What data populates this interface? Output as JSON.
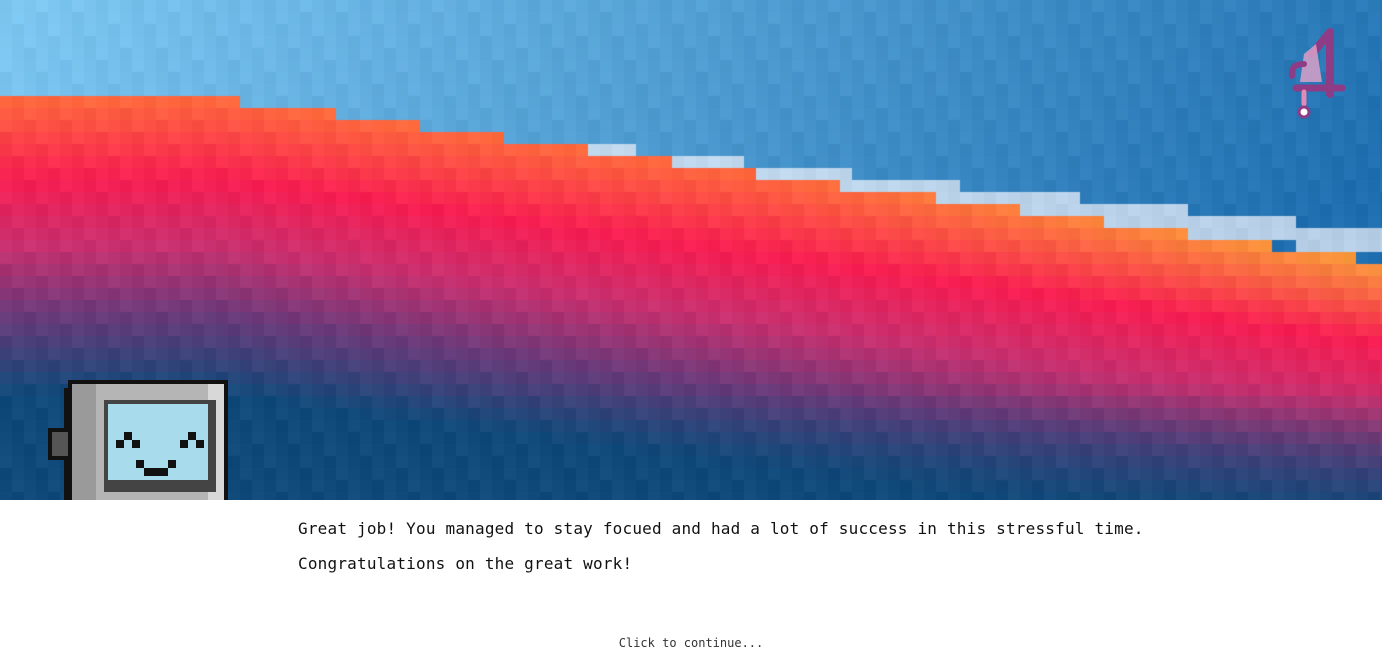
{
  "dialog": {
    "lines": [
      "Great job! You managed to stay focued and had a lot of success in this stressful time.",
      "Congratulations on the great work!"
    ],
    "continue_prompt": "Click to continue..."
  },
  "badge": {
    "value": "1",
    "color": "#8e3c86",
    "fill": "#d9a0c8"
  },
  "robot": {
    "icon": "happy-tv-robot",
    "screen_color": "#a8dcec",
    "body_color": "#a9a9a9"
  },
  "scene": {
    "background": "pixelated-sunset-wallpaper",
    "colors": {
      "sky_light": "#7ec8f2",
      "sky_dark": "#1f6fb0",
      "band_orange": "#ff6a3d",
      "band_red": "#f71e52",
      "band_yellow": "#f7a93a",
      "band_magenta": "#c8306f",
      "band_purple": "#6b3a7a",
      "bottom_navy": "#0f4a7a"
    }
  }
}
